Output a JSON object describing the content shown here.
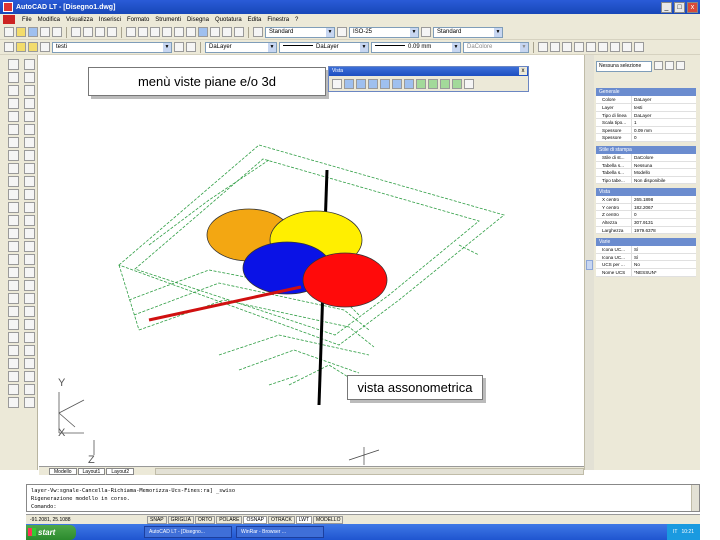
{
  "window": {
    "title": "AutoCAD LT - [Disegno1.dwg]",
    "controls": {
      "minimize": "_",
      "maximize": "□",
      "close": "x"
    }
  },
  "menu": {
    "items": [
      "File",
      "Modifica",
      "Visualizza",
      "Inserisci",
      "Formato",
      "Strumenti",
      "Disegna",
      "Quotatura",
      "Edita",
      "Finestra",
      "?"
    ]
  },
  "toolbars": {
    "style_text": "Standard",
    "dim_style": "ISO-25",
    "table_style": "Standard",
    "layer_name": "testi",
    "color": "DaLayer",
    "linetype": "DaLayer",
    "lineweight": "0.09 mm",
    "plot_style": "DaColore"
  },
  "callouts": {
    "views_menu": "menù viste piane e/o 3d",
    "axonometric": "vista assonometrica"
  },
  "view_toolbar": {
    "title": "Vista",
    "close": "x"
  },
  "ucs_icon": {
    "x": "X",
    "y": "Y",
    "z": "Z"
  },
  "properties": {
    "selection": "Nessuna selezione",
    "sections": [
      {
        "title": "Generale",
        "rows": [
          {
            "k": "Colore",
            "v": "DaLayer"
          },
          {
            "k": "Layer",
            "v": "testi"
          },
          {
            "k": "Tipo di linea",
            "v": "DaLayer"
          },
          {
            "k": "Scala tipo...",
            "v": "1"
          },
          {
            "k": "Spessore",
            "v": "0.09 mm"
          },
          {
            "k": "Spessore",
            "v": "0"
          }
        ]
      },
      {
        "title": "Stile di stampa",
        "rows": [
          {
            "k": "Stile di st...",
            "v": "DaColore"
          },
          {
            "k": "Tabella s...",
            "v": "Nessuna"
          },
          {
            "k": "Tabella s...",
            "v": "Modello"
          },
          {
            "k": "Tipo tabe...",
            "v": "Non disponibile"
          }
        ]
      },
      {
        "title": "Vista",
        "rows": [
          {
            "k": "X centro",
            "v": "265.1898"
          },
          {
            "k": "Y centro",
            "v": "182.2067"
          },
          {
            "k": "Z centro",
            "v": "0"
          },
          {
            "k": "Altezza",
            "v": "307.9131"
          },
          {
            "k": "Larghezza",
            "v": "1979.6378"
          }
        ]
      },
      {
        "title": "Varie",
        "rows": [
          {
            "k": "Icona UC...",
            "v": "Sì"
          },
          {
            "k": "Icona UC...",
            "v": "Sì"
          },
          {
            "k": "UCS per ...",
            "v": "No"
          },
          {
            "k": "Nome UCS",
            "v": "*NESSUN*"
          }
        ]
      }
    ]
  },
  "tabs": [
    "Modello",
    "Layout1",
    "Layout2"
  ],
  "command_line": [
    "layer-Vw:sgnale-Cancella-Richiama-Memorizza-Ucs-Fines:ra] _swiso",
    "Rigenerazione modello in corso.",
    "Comando:"
  ],
  "status": {
    "coords": "-91.2081, 25.1088",
    "buttons": [
      "SNAP",
      "GRIGLIA",
      "ORTO",
      "POLARE",
      "OSNAP",
      "OTRACK",
      "LWT",
      "MODELLO"
    ]
  },
  "taskbar": {
    "start": "start",
    "items": [
      "AutoCAD LT - [Disegno...",
      "WinRar - Browser ..."
    ],
    "tray": [
      "IT",
      "10:21"
    ]
  }
}
